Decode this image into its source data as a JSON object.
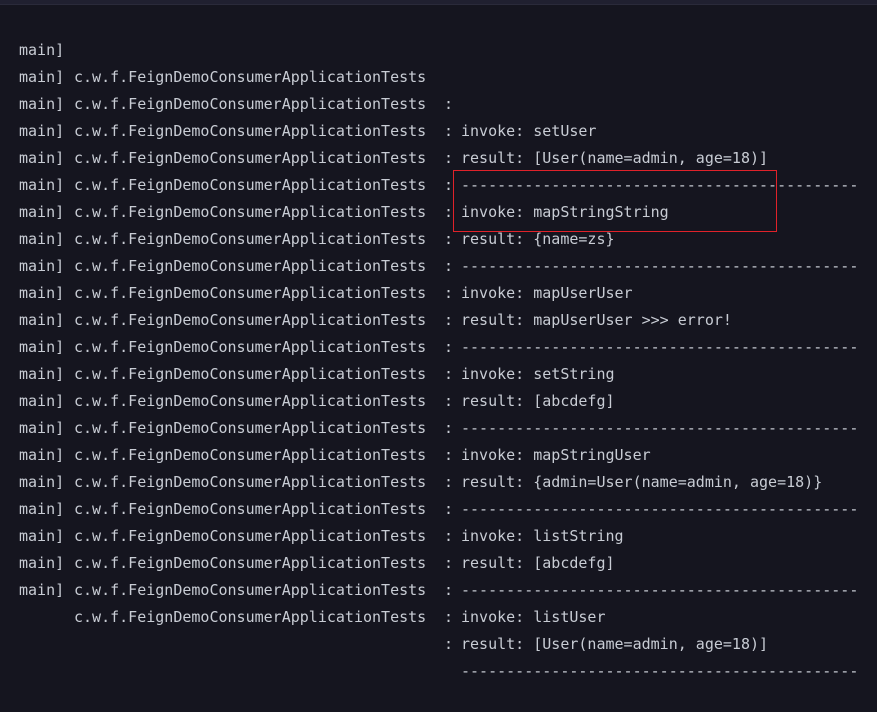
{
  "console": {
    "lines": [
      {
        "thread": "main]",
        "logger": "c.w.f.FeignDemoConsumerApplicationTests",
        "sep": ":",
        "message": "invoke: setUser"
      },
      {
        "thread": "main]",
        "logger": "c.w.f.FeignDemoConsumerApplicationTests",
        "sep": ":",
        "message": "result: [User(name=admin, age=18)]"
      },
      {
        "thread": "main]",
        "logger": "c.w.f.FeignDemoConsumerApplicationTests",
        "sep": ":",
        "message": "--------------------------------------------"
      },
      {
        "thread": "main]",
        "logger": "c.w.f.FeignDemoConsumerApplicationTests",
        "sep": ":",
        "message": "invoke: mapStringString"
      },
      {
        "thread": "main]",
        "logger": "c.w.f.FeignDemoConsumerApplicationTests",
        "sep": ":",
        "message": "result: {name=zs}"
      },
      {
        "thread": "main]",
        "logger": "c.w.f.FeignDemoConsumerApplicationTests",
        "sep": ":",
        "message": "--------------------------------------------"
      },
      {
        "thread": "main]",
        "logger": "c.w.f.FeignDemoConsumerApplicationTests",
        "sep": ":",
        "message": "invoke: mapUserUser"
      },
      {
        "thread": "main]",
        "logger": "c.w.f.FeignDemoConsumerApplicationTests",
        "sep": ":",
        "message": "result: mapUserUser >>> error!"
      },
      {
        "thread": "main]",
        "logger": "c.w.f.FeignDemoConsumerApplicationTests",
        "sep": ":",
        "message": "--------------------------------------------"
      },
      {
        "thread": "main]",
        "logger": "c.w.f.FeignDemoConsumerApplicationTests",
        "sep": ":",
        "message": "invoke: setString"
      },
      {
        "thread": "main]",
        "logger": "c.w.f.FeignDemoConsumerApplicationTests",
        "sep": ":",
        "message": "result: [abcdefg]"
      },
      {
        "thread": "main]",
        "logger": "c.w.f.FeignDemoConsumerApplicationTests",
        "sep": ":",
        "message": "--------------------------------------------"
      },
      {
        "thread": "main]",
        "logger": "c.w.f.FeignDemoConsumerApplicationTests",
        "sep": ":",
        "message": "invoke: mapStringUser"
      },
      {
        "thread": "main]",
        "logger": "c.w.f.FeignDemoConsumerApplicationTests",
        "sep": ":",
        "message": "result: {admin=User(name=admin, age=18)}"
      },
      {
        "thread": "main]",
        "logger": "c.w.f.FeignDemoConsumerApplicationTests",
        "sep": ":",
        "message": "--------------------------------------------"
      },
      {
        "thread": "main]",
        "logger": "c.w.f.FeignDemoConsumerApplicationTests",
        "sep": ":",
        "message": "invoke: listString"
      },
      {
        "thread": "main]",
        "logger": "c.w.f.FeignDemoConsumerApplicationTests",
        "sep": ":",
        "message": "result: [abcdefg]"
      },
      {
        "thread": "main]",
        "logger": "c.w.f.FeignDemoConsumerApplicationTests",
        "sep": ":",
        "message": "--------------------------------------------"
      },
      {
        "thread": "main]",
        "logger": "c.w.f.FeignDemoConsumerApplicationTests",
        "sep": ":",
        "message": "invoke: listUser"
      },
      {
        "thread": "main]",
        "logger": "c.w.f.FeignDemoConsumerApplicationTests",
        "sep": ":",
        "message": "result: [User(name=admin, age=18)]"
      },
      {
        "thread": "main]",
        "logger": "c.w.f.FeignDemoConsumerApplicationTests",
        "sep": ":",
        "message": "--------------------------------------------"
      }
    ],
    "colors": {
      "background": "#15151f",
      "text": "#c8ccd4",
      "highlight_border": "#e0222a"
    }
  }
}
